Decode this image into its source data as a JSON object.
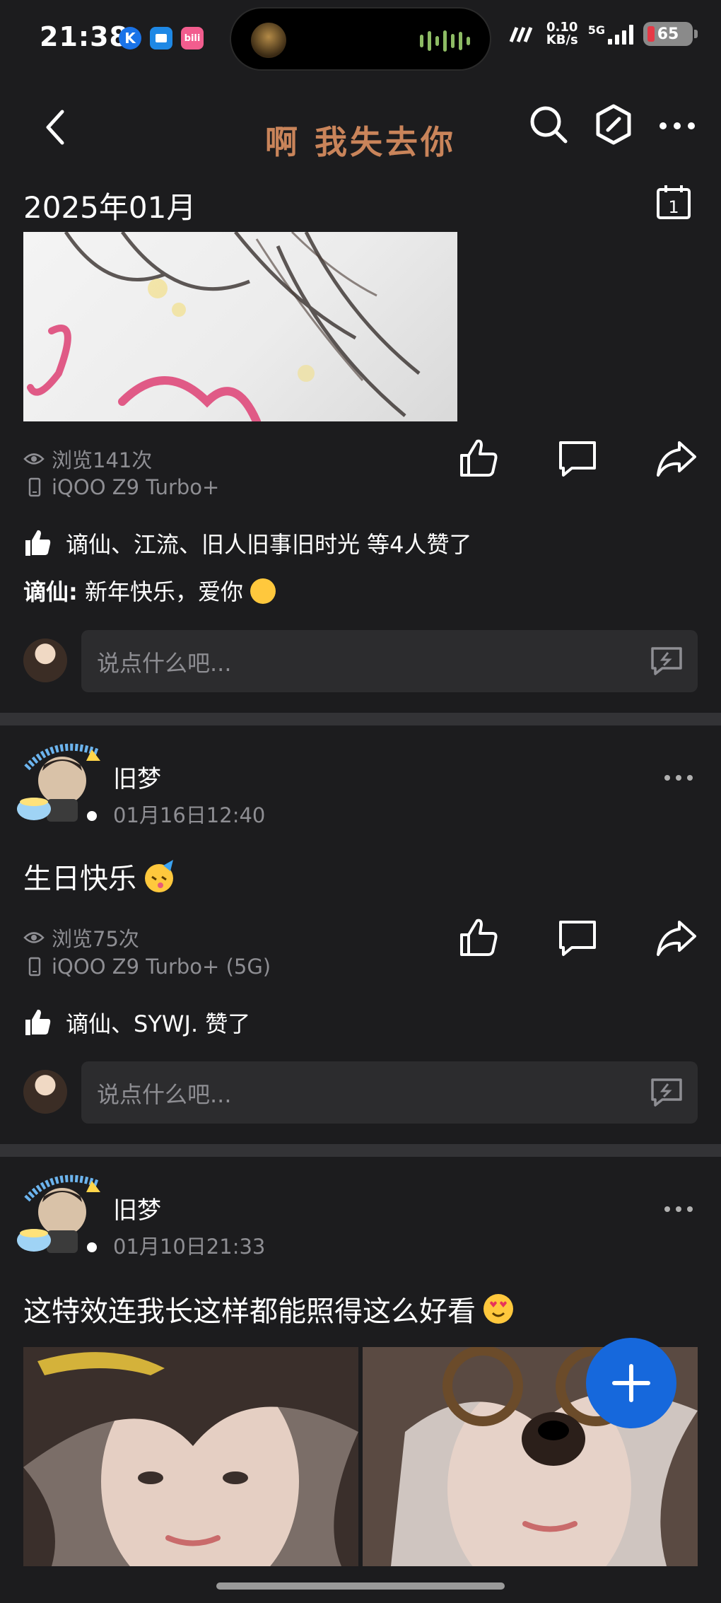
{
  "status_bar": {
    "time": "21:38",
    "net_speed_value": "0.10",
    "net_speed_unit": "KB/s",
    "network_type": "5G",
    "battery": "65",
    "apps": [
      {
        "icon": "k-app-icon",
        "label": "K",
        "color": "#1a73e8"
      },
      {
        "icon": "blue-app-icon",
        "label": "▪",
        "color": "#1e88e5"
      },
      {
        "icon": "bilibili-app-icon",
        "label": "bili",
        "color": "#f25d8e"
      }
    ]
  },
  "nav": {
    "title": "啊 我失去你",
    "back_icon": "chevron-left-icon",
    "search_icon": "search-icon",
    "hex_icon": "hexagon-icon",
    "more_icon": "more-icon"
  },
  "date_header": {
    "text": "2025年01月",
    "icon": "calendar-icon",
    "calendar_day": "1"
  },
  "post1": {
    "views": "浏览141次",
    "device": "iQOO Z9 Turbo+",
    "likes_text": "谪仙、江流、旧人旧事旧时光 等4人赞了",
    "comment_author": "谪仙:",
    "comment_text": "新年快乐，爱你",
    "reply_placeholder": "说点什么吧..."
  },
  "post2": {
    "author": "旧梦",
    "time": "01月16日12:40",
    "text": "生日快乐",
    "views": "浏览75次",
    "device": "iQOO Z9 Turbo+ (5G)",
    "likes_text": "谪仙、SYWJ. 赞了",
    "reply_placeholder": "说点什么吧..."
  },
  "post3": {
    "author": "旧梦",
    "time": "01月10日21:33",
    "text": "这特效连我长这样都能照得这么好看"
  },
  "colors": {
    "background": "#1c1c1e",
    "accent": "#1668dc",
    "title": "#c9845a",
    "muted": "#8e8e93"
  }
}
